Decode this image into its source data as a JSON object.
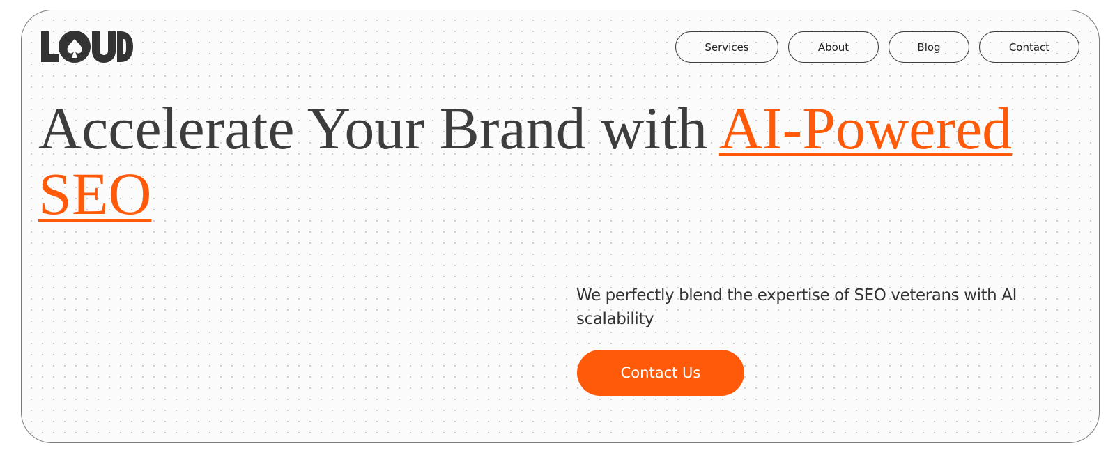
{
  "brand": {
    "logo_text": "LOUD",
    "logo_color": "#333333"
  },
  "nav": {
    "items": [
      {
        "label": "Services"
      },
      {
        "label": "About"
      },
      {
        "label": "Blog"
      },
      {
        "label": "Contact"
      }
    ]
  },
  "hero": {
    "headline_main": "Accelerate Your Brand with ",
    "headline_accent": "AI-Powered SEO",
    "subtext": "We perfectly blend the expertise of SEO veterans with AI scalability",
    "cta_label": "Contact Us"
  },
  "colors": {
    "accent": "#ff5a0a",
    "text": "#3d3d3d",
    "border": "#7a7a7a"
  }
}
